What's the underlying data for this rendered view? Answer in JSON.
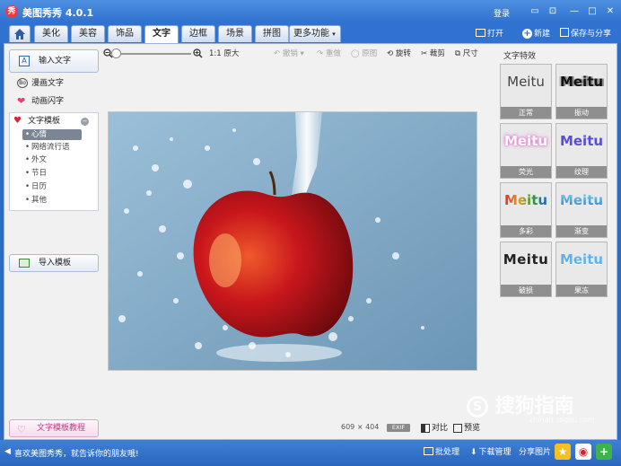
{
  "app": {
    "title": "美图秀秀 4.0.1",
    "login": "登录"
  },
  "tabs": [
    "美化",
    "美容",
    "饰品",
    "文字",
    "边框",
    "场景",
    "拼图",
    "更多功能"
  ],
  "active_tab": "文字",
  "top_tools": {
    "open": "打开",
    "new": "新建",
    "save": "保存与分享"
  },
  "left_panel": {
    "input_text": "输入文字",
    "comic_text": "漫画文字",
    "animated_text": "动画闪字",
    "template_header": "文字模板",
    "template_items": [
      "心情",
      "网络流行语",
      "外文",
      "节日",
      "日历",
      "其他"
    ],
    "import_template": "导入模板",
    "tutorial": "文字模板教程"
  },
  "toolbar": {
    "original_size": "1:1 原大",
    "undo": "撤销",
    "redo": "重做",
    "original_image": "原图",
    "rotate": "旋转",
    "crop": "裁剪",
    "size": "尺寸"
  },
  "canvas_info": {
    "width": "609",
    "x": "×",
    "height": "404",
    "exif": "EXIF",
    "compare": "对比",
    "preview": "预览"
  },
  "right_panel": {
    "title": "文字特效",
    "effects": [
      {
        "sample": "Meitu",
        "label": "正常"
      },
      {
        "sample": "Meitu",
        "label": "振动"
      },
      {
        "sample": "Meitu",
        "label": "荧光"
      },
      {
        "sample": "Meitu",
        "label": "纹理"
      },
      {
        "sample": "Meitu",
        "label": "多彩"
      },
      {
        "sample": "Meitu",
        "label": "渐变"
      },
      {
        "sample": "Meitu",
        "label": "破损"
      },
      {
        "sample": "Meitu",
        "label": "果冻"
      }
    ]
  },
  "status": {
    "message": "喜欢美图秀秀，就告诉你的朋友哦!",
    "batch": "批处理",
    "download": "下载管理",
    "share": "分享图片"
  },
  "watermark": {
    "text": "搜狗指南",
    "url": "zhinan.sogou.com"
  },
  "colors": {
    "title_blue": "#2f72cf",
    "apple_red": "#c8161c",
    "bg_blue": "#7ea8c5"
  }
}
